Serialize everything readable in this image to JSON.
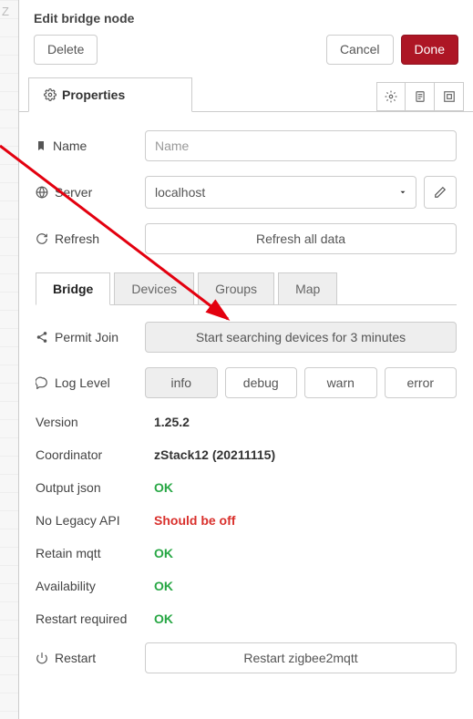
{
  "grid_letter": "Z",
  "header": {
    "title": "Edit bridge node",
    "delete": "Delete",
    "cancel": "Cancel",
    "done": "Done"
  },
  "main_tab": {
    "label": "Properties"
  },
  "fields": {
    "name": {
      "label": "Name",
      "placeholder": "Name",
      "value": ""
    },
    "server": {
      "label": "Server",
      "value": "localhost"
    },
    "refresh": {
      "label": "Refresh",
      "button": "Refresh all data"
    },
    "permit_join": {
      "label": "Permit Join",
      "button": "Start searching devices for 3 minutes"
    },
    "log_level": {
      "label": "Log Level",
      "options": [
        "info",
        "debug",
        "warn",
        "error"
      ],
      "active": "info"
    },
    "restart": {
      "label": "Restart",
      "button": "Restart zigbee2mqtt"
    }
  },
  "inner_tabs": [
    "Bridge",
    "Devices",
    "Groups",
    "Map"
  ],
  "inner_tabs_active": "Bridge",
  "kv": [
    {
      "label": "Version",
      "value": "1.25.2",
      "status": "normal"
    },
    {
      "label": "Coordinator",
      "value": "zStack12 (20211115)",
      "status": "normal"
    },
    {
      "label": "Output json",
      "value": "OK",
      "status": "ok"
    },
    {
      "label": "No Legacy API",
      "value": "Should be off",
      "status": "bad"
    },
    {
      "label": "Retain mqtt",
      "value": "OK",
      "status": "ok"
    },
    {
      "label": "Availability",
      "value": "OK",
      "status": "ok"
    },
    {
      "label": "Restart required",
      "value": "OK",
      "status": "ok"
    }
  ]
}
